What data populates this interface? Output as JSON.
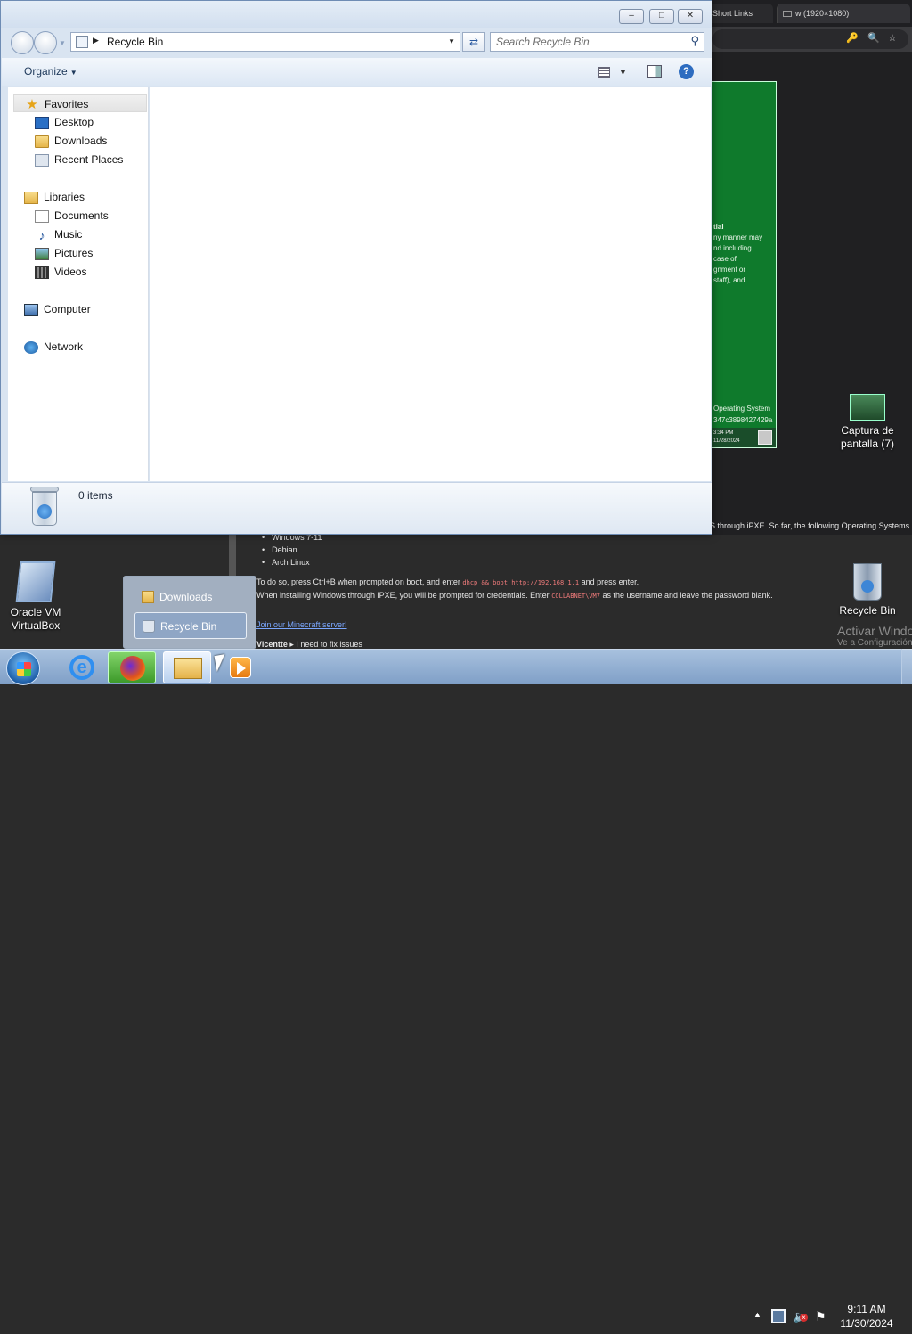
{
  "browser": {
    "tabs": [
      {
        "label": "Short Links"
      },
      {
        "label": "w (1920×1080)"
      }
    ],
    "notice": {
      "lines": [
        "tial",
        "ny manner may",
        "nd including",
        "case of",
        "gnment or",
        "staff), and"
      ],
      "footer_lines": [
        "Operating System",
        "347c3898427429a"
      ],
      "time": "3:34 PM",
      "date": "11/28/2024"
    },
    "article": {
      "top_line": "S through iPXE. So far, the following Operating Systems a",
      "os_list": [
        "Windows 7-11",
        "Debian",
        "Arch Linux"
      ],
      "boot_text_1": "To do so, press Ctrl+B when prompted on boot, and enter",
      "boot_code": "dhcp && boot http://192.168.1.1",
      "boot_text_2": "and press enter.",
      "cred_text_1": "When installing Windows through iPXE, you will be prompted for credentials. Enter",
      "cred_code": "COLLABNET\\VM7",
      "cred_text_2": "as the username and leave the password blank.",
      "link": "Join our Minecraft server!",
      "author": "Vicentte",
      "author_msg": "I need to fix issues"
    }
  },
  "explorer": {
    "caption_buttons": {
      "minimize": "–",
      "maximize": "□",
      "close": "✕"
    },
    "address": "Recycle Bin",
    "search_placeholder": "Search Recycle Bin",
    "organize_label": "Organize",
    "help_label": "?",
    "nav": {
      "favorites": "Favorites",
      "desktop": "Desktop",
      "downloads": "Downloads",
      "recent": "Recent Places",
      "libraries": "Libraries",
      "documents": "Documents",
      "music": "Music",
      "pictures": "Pictures",
      "videos": "Videos",
      "computer": "Computer",
      "network": "Network"
    },
    "details_count": "0 items"
  },
  "desktop": {
    "icons": {
      "virtualbox": "Oracle VM VirtualBox",
      "captura": "Captura de pantalla (7)",
      "recycle": "Recycle Bin"
    },
    "watermark": "Activar Windows",
    "watermark_sub": "Ve a Configuración"
  },
  "jumplist": {
    "downloads": "Downloads",
    "recycle": "Recycle Bin"
  },
  "taskbar": {
    "time": "9:11 AM",
    "date": "11/30/2024"
  },
  "icons": [
    "start-orb-icon",
    "ie-icon",
    "firefox-icon",
    "explorer-icon",
    "media-player-icon",
    "network-icon",
    "volume-muted-icon",
    "action-center-flag-icon"
  ]
}
